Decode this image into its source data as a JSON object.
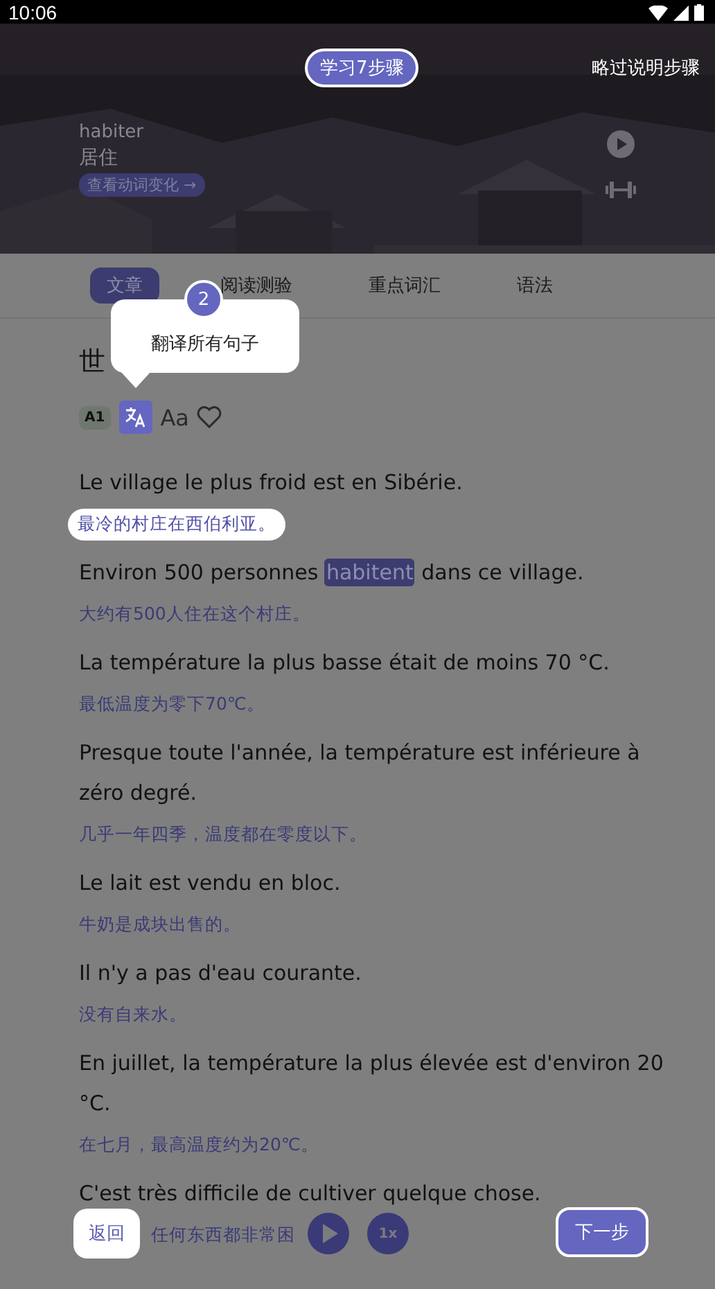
{
  "status_bar": {
    "time": "10:06"
  },
  "header": {
    "step_badge": "学习7步骤",
    "skip": "略过说明步骤",
    "word": "habiter",
    "meaning": "居住",
    "conjugation_link": "查看动词变化 →"
  },
  "tabs": [
    {
      "label": "文章",
      "selected": true
    },
    {
      "label": "阅读测验",
      "selected": false
    },
    {
      "label": "重点词汇",
      "selected": false
    },
    {
      "label": "语法",
      "selected": false
    }
  ],
  "article": {
    "title": "世",
    "level": "A1",
    "font_button": "Aa"
  },
  "tooltip": {
    "step": "2",
    "text": "翻译所有句子"
  },
  "sentences": [
    {
      "parts": [
        {
          "text": "Le village le plus froid est en Sibérie.",
          "highlighted": false
        }
      ],
      "translation": "最冷的村庄在西伯利亚。",
      "spotlight": true
    },
    {
      "parts": [
        {
          "text": "Environ 500 personnes ",
          "highlighted": false
        },
        {
          "text": "habitent",
          "highlighted": true
        },
        {
          "text": " dans ce village.",
          "highlighted": false
        }
      ],
      "translation": "大约有500人住在这个村庄。",
      "spotlight": false
    },
    {
      "parts": [
        {
          "text": "La température la plus basse était de moins 70 °C.",
          "highlighted": false
        }
      ],
      "translation": "最低温度为零下70℃。",
      "spotlight": false
    },
    {
      "parts": [
        {
          "text": "Presque toute l'année, la température est inférieure à zéro degré.",
          "highlighted": false
        }
      ],
      "translation": "几乎一年四季，温度都在零度以下。",
      "spotlight": false
    },
    {
      "parts": [
        {
          "text": "Le lait est vendu en bloc.",
          "highlighted": false
        }
      ],
      "translation": "牛奶是成块出售的。",
      "spotlight": false
    },
    {
      "parts": [
        {
          "text": "Il n'y a pas d'eau courante.",
          "highlighted": false
        }
      ],
      "translation": "没有自来水。",
      "spotlight": false
    },
    {
      "parts": [
        {
          "text": "En juillet, la température la plus élevée est d'environ 20 °C.",
          "highlighted": false
        }
      ],
      "translation": "在七月，最高温度约为20℃。",
      "spotlight": false
    },
    {
      "parts": [
        {
          "text": "C'est très difficile de cultiver quelque chose.",
          "highlighted": false
        }
      ],
      "translation": "任何东西都非常困",
      "spotlight": false
    }
  ],
  "footer": {
    "back": "返回",
    "speed": "1x",
    "next": "下一步"
  }
}
